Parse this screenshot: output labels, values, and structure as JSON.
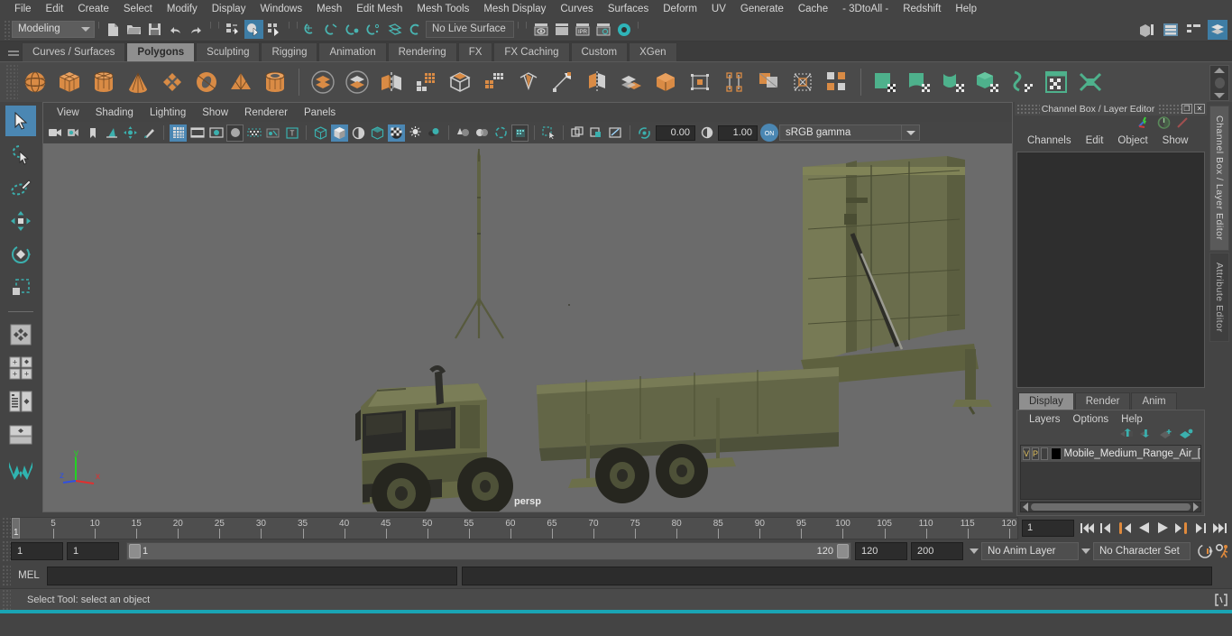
{
  "menubar": {
    "items": [
      "File",
      "Edit",
      "Create",
      "Select",
      "Modify",
      "Display",
      "Windows",
      "Mesh",
      "Edit Mesh",
      "Mesh Tools",
      "Mesh Display",
      "Curves",
      "Surfaces",
      "Deform",
      "UV",
      "Generate",
      "Cache",
      "- 3DtoAll -",
      "Redshift",
      "Help"
    ]
  },
  "statusline": {
    "menuset": "Modeling",
    "live_surface": "No Live Surface",
    "icons": [
      "new-scene-icon",
      "open-scene-icon",
      "save-scene-icon",
      "undo-icon",
      "redo-icon",
      "select-by-hierarchy-icon",
      "select-by-object-icon",
      "select-by-component-icon",
      "snap-to-grid-icon",
      "snap-to-curve-icon",
      "snap-to-point-icon",
      "snap-to-projected-center-icon",
      "snap-to-view-plane-icon",
      "make-live-icon",
      "render-current-frame-icon",
      "ipr-render-icon",
      "render-settings-icon",
      "hypershade-icon",
      "toggle-render-view-icon"
    ],
    "topright_icons": [
      "sidebar-layout-icon",
      "attribute-editor-icon",
      "tool-settings-icon",
      "channel-box-icon"
    ]
  },
  "shelf": {
    "tabs": [
      "Curves / Surfaces",
      "Polygons",
      "Sculpting",
      "Rigging",
      "Animation",
      "Rendering",
      "FX",
      "FX Caching",
      "Custom",
      "XGen"
    ],
    "active_tab": "Polygons",
    "icons": [
      "poly-sphere-icon",
      "poly-cube-icon",
      "poly-cylinder-icon",
      "poly-cone-icon",
      "poly-plane-icon",
      "poly-torus-icon",
      "poly-pyramid-icon",
      "poly-pipe-icon",
      "combine-icon",
      "separate-icon",
      "mirror-geometry-icon",
      "smooth-icon",
      "boolean-icon",
      "extrude-icon",
      "bevel-icon",
      "multi-cut-icon",
      "insert-edge-loop-icon",
      "offset-edge-loop-icon",
      "target-weld-icon",
      "bridge-icon",
      "append-polygon-icon",
      "poly-merge-icon",
      "quad-draw-icon",
      "uv-planar-icon",
      "uv-cylindrical-icon",
      "uv-spherical-icon",
      "uv-automatic-icon",
      "uv-unfold-icon",
      "uv-editor-icon",
      "uv-layout-icon"
    ]
  },
  "viewport_panel": {
    "menus": [
      "View",
      "Shading",
      "Lighting",
      "Show",
      "Renderer",
      "Panels"
    ],
    "exposure": "0.00",
    "gamma_value": "1.00",
    "color_management": "sRGB gamma",
    "camera_label": "persp",
    "axis_labels": {
      "x": "x",
      "y": "y",
      "z": "z"
    },
    "toolbar_icons": [
      "select-camera-icon",
      "camera-attributes-icon",
      "bookmark-icon",
      "image-plane-icon",
      "2d-pan-zoom-icon",
      "grease-pencil-icon",
      "grid-toggle-icon",
      "film-gate-icon",
      "resolution-gate-icon",
      "gate-mask-icon",
      "film-origin-icon",
      "xray-joints-icon",
      "text-overlay-icon",
      "wireframe-icon",
      "smooth-shade-icon",
      "shaded-wireframe-icon",
      "textured-icon",
      "use-default-lighting-icon",
      "use-all-lights-icon",
      "shadows-icon",
      "screen-space-ao-icon",
      "motion-blur-icon",
      "multisample-icon",
      "isolate-select-icon",
      "xray-icon",
      "xray-active-components-icon",
      "xray-joints2-icon",
      "exposure-icon",
      "gamma-icon",
      "color-management-toggle-icon"
    ]
  },
  "toolbox": {
    "tools": [
      "select-tool",
      "lasso-select-tool",
      "paint-select-tool",
      "move-tool",
      "rotate-tool",
      "scale-tool",
      "last-tool-used",
      "snap-settings",
      "layout-quad-view",
      "layout-outliner-persp",
      "layout-single-persp"
    ],
    "active": "select-tool"
  },
  "channel_box": {
    "title": "Channel Box / Layer Editor",
    "menus": [
      "Channels",
      "Edit",
      "Object",
      "Show"
    ],
    "icons": [
      "channel-box-icon",
      "attribute-editor-toggle-icon",
      "modeling-toolkit-icon"
    ],
    "window_buttons": [
      "restore-icon",
      "close-icon"
    ]
  },
  "layer_editor": {
    "tabs": [
      "Display",
      "Render",
      "Anim"
    ],
    "active_tab": "Display",
    "menus": [
      "Layers",
      "Options",
      "Help"
    ],
    "toolbar_icons": [
      "move-layer-up-icon",
      "move-layer-down-icon",
      "new-layer-icon",
      "new-layer-from-selected-icon"
    ],
    "layers": [
      {
        "visibility": "V",
        "playback": "P",
        "template": "",
        "color": "#000000",
        "name": "Mobile_Medium_Range_Air_["
      }
    ]
  },
  "side_tabs": [
    {
      "label": "Channel Box / Layer Editor",
      "active": true
    },
    {
      "label": "Attribute Editor",
      "active": false
    }
  ],
  "time_slider": {
    "start_visible": 1,
    "tick_labels": [
      5,
      10,
      15,
      20,
      25,
      30,
      35,
      40,
      45,
      50,
      55,
      60,
      65,
      70,
      75,
      80,
      85,
      90,
      95,
      100,
      105,
      110,
      115,
      120
    ],
    "current_frame_marker": "1",
    "current_frame_field": "1",
    "playback_icons": [
      "go-to-start-icon",
      "step-back-keyframe-icon",
      "step-back-frame-icon",
      "play-backwards-icon",
      "play-forwards-icon",
      "step-forward-frame-icon",
      "step-forward-keyframe-icon",
      "go-to-end-icon"
    ]
  },
  "range_slider": {
    "anim_start": "1",
    "range_start": "1",
    "bar_left_value": "1",
    "bar_right_value": "120",
    "range_end": "120",
    "anim_end": "200",
    "anim_layer": "No Anim Layer",
    "character_set": "No Character Set",
    "icons": [
      "auto-keyframe-icon",
      "animation-preferences-icon"
    ]
  },
  "command_line": {
    "language_label": "MEL",
    "input_value": "",
    "output_value": "",
    "script_editor_icon": "script-editor-icon"
  },
  "help_line": {
    "message": "Select Tool: select an object"
  },
  "colors": {
    "accent_blue": "#4b87b3",
    "shelf_orange": "#d98b45",
    "teal": "#3ab0ad",
    "bg_dark": "#2e2e2e",
    "bg_mid": "#444444",
    "viewport_bg": "#6b6b6b",
    "model_green": "#5a5d3c",
    "bottom_strip": "#1aa5b5"
  }
}
